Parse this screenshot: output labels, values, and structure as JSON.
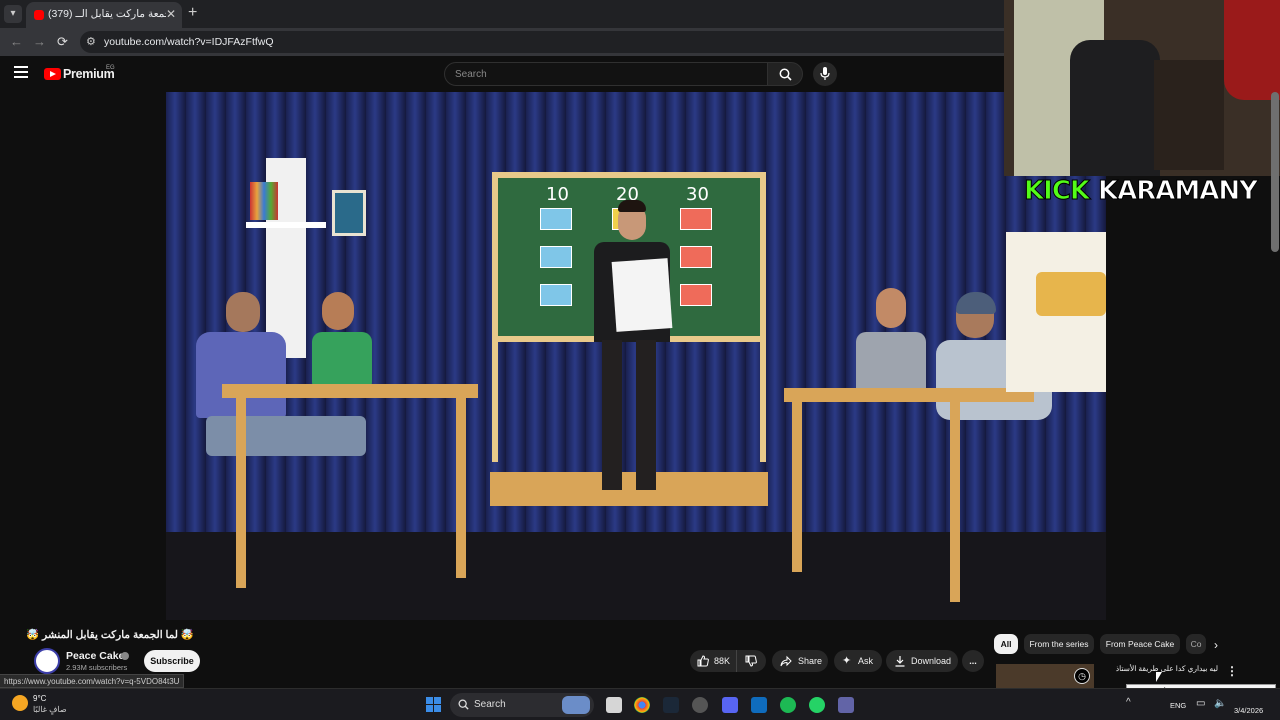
{
  "browser": {
    "tab_title": "(379) لما الجمعة ماركت يقابل الــ",
    "address": "youtube.com/watch?v=IDJFAzFtfwQ",
    "status_url": "https://www.youtube.com/watch?v=q-5VDO84t3U"
  },
  "youtube": {
    "brand": "Premium",
    "country": "EG",
    "search_placeholder": "Search"
  },
  "video": {
    "board_numbers": [
      "10",
      "20",
      "30"
    ],
    "title": "🤯 لما الجمعة ماركت يقابل المنشر 🤯",
    "channel": "Peace Cake",
    "subscribers": "2.93M subscribers",
    "subscribe_label": "Subscribe",
    "likes": "88K",
    "share_label": "Share",
    "ask_label": "Ask",
    "download_label": "Download",
    "more_label": "..."
  },
  "overlay": {
    "kick": "KICK",
    "name": "KARAMANY"
  },
  "recommendations": {
    "chips": [
      "All",
      "From the series",
      "From Peace Cake",
      "Co"
    ],
    "first_title": "ليه بيداري كدا على طريقة الأستاذ",
    "tooltip": "ليه بيداري كدا على طريقة الأستاذ"
  },
  "taskbar": {
    "weather_temp": "9°C",
    "weather_desc": "صافٍ غالبًا",
    "search_label": "Search",
    "lang": "ENG",
    "time": "",
    "date": "3/4/2026"
  },
  "colors": {
    "youtube_red": "#ff0000",
    "kick_green": "#53fc18",
    "curtain_blue": "#1c2347",
    "board_green": "#2f6a3f"
  }
}
